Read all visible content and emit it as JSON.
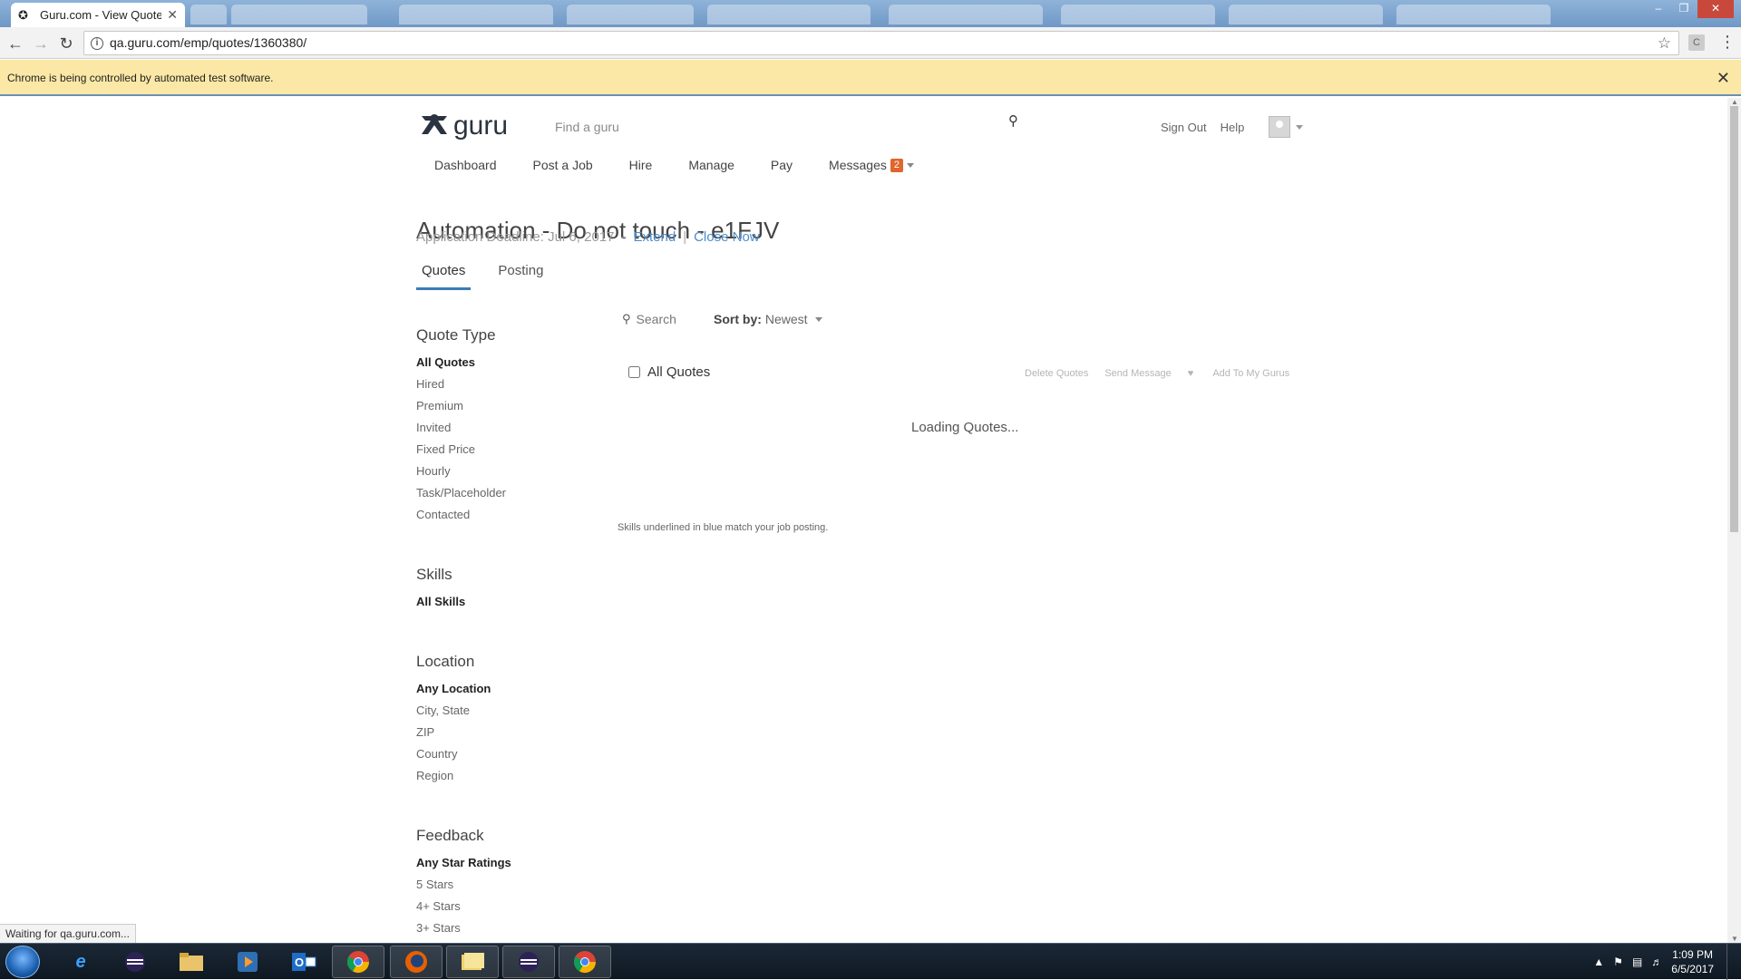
{
  "browser": {
    "active_tab_title": "Guru.com - View Quotes",
    "url": "qa.guru.com/emp/quotes/1360380/",
    "infobar_message": "Chrome is being controlled by automated test software.",
    "status_text": "Waiting for qa.guru.com..."
  },
  "header": {
    "search_placeholder": "Find a guru",
    "sign_out": "Sign Out",
    "help": "Help"
  },
  "nav": {
    "dashboard": "Dashboard",
    "post_job": "Post a Job",
    "hire": "Hire",
    "manage": "Manage",
    "pay": "Pay",
    "messages": "Messages",
    "messages_count": "2"
  },
  "job": {
    "title": "Automation - Do not touch - e1FJV",
    "deadline_label": "Application Deadline: Jul 6, 2017",
    "dash": "-",
    "extend": "Extend",
    "separator": "|",
    "close_now": "Close Now"
  },
  "tabs": {
    "quotes": "Quotes",
    "posting": "Posting"
  },
  "filters": {
    "quote_type": {
      "heading": "Quote Type",
      "items": [
        "All Quotes",
        "Hired",
        "Premium",
        "Invited",
        "Fixed Price",
        "Hourly",
        "Task/Placeholder",
        "Contacted"
      ]
    },
    "skills": {
      "heading": "Skills",
      "items": [
        "All Skills"
      ]
    },
    "location": {
      "heading": "Location",
      "items": [
        "Any Location",
        "City, State",
        "ZIP",
        "Country",
        "Region"
      ]
    },
    "feedback": {
      "heading": "Feedback",
      "items": [
        "Any Star Ratings",
        "5 Stars",
        "4+ Stars",
        "3+ Stars"
      ]
    }
  },
  "results": {
    "search_label": "Search",
    "sort_label": "Sort by:",
    "sort_value": "Newest",
    "all_quotes_label": "All Quotes",
    "delete_quotes": "Delete Quotes",
    "send_message": "Send Message",
    "add_to_my_gurus": "Add To My Gurus",
    "loading": "Loading Quotes...",
    "skills_note": "Skills underlined in blue match your job posting."
  },
  "taskbar": {
    "time": "1:09 PM",
    "date": "6/5/2017"
  },
  "colors": {
    "link_blue": "#4f8cc9",
    "tab_underline": "#3d7bb8",
    "badge_orange": "#e0662c",
    "infobar_yellow": "#fbe8a6"
  }
}
